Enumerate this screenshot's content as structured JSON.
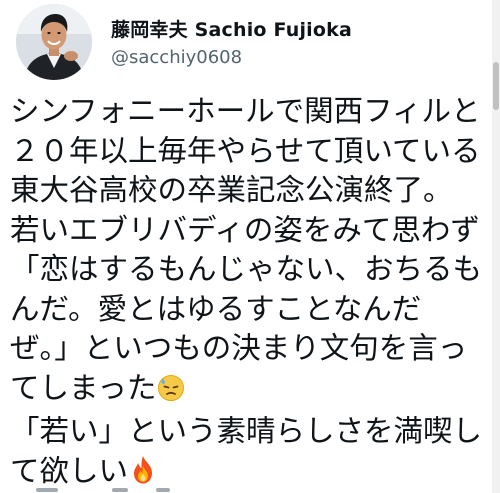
{
  "tweet": {
    "author_name": "藤岡幸夫 Sachio Fujioka",
    "author_handle": "@sacchiy0608",
    "avatar_icon": "profile-photo-avatar",
    "lines": [
      "シンフォニーホールで関西フィルと",
      "２０年以上毎年やらせて頂いている",
      "東大谷高校の卒業記念公演終了。",
      "若いエブリバディの姿をみて思わず",
      "「恋はするもんじゃない、おちるも",
      "んだ。愛とはゆるすことなんだ",
      "ぜ。」といつもの決まり文句を言っ",
      "てしまった",
      "「若い」という素晴らしさを満喫し",
      "て欲しい"
    ],
    "emojis": {
      "line8": "downcast-face-with-sweat-emoji",
      "line10": "fire-emoji"
    }
  },
  "colors": {
    "text": "#0f1419",
    "secondary_text": "#536471",
    "background": "#ffffff"
  }
}
